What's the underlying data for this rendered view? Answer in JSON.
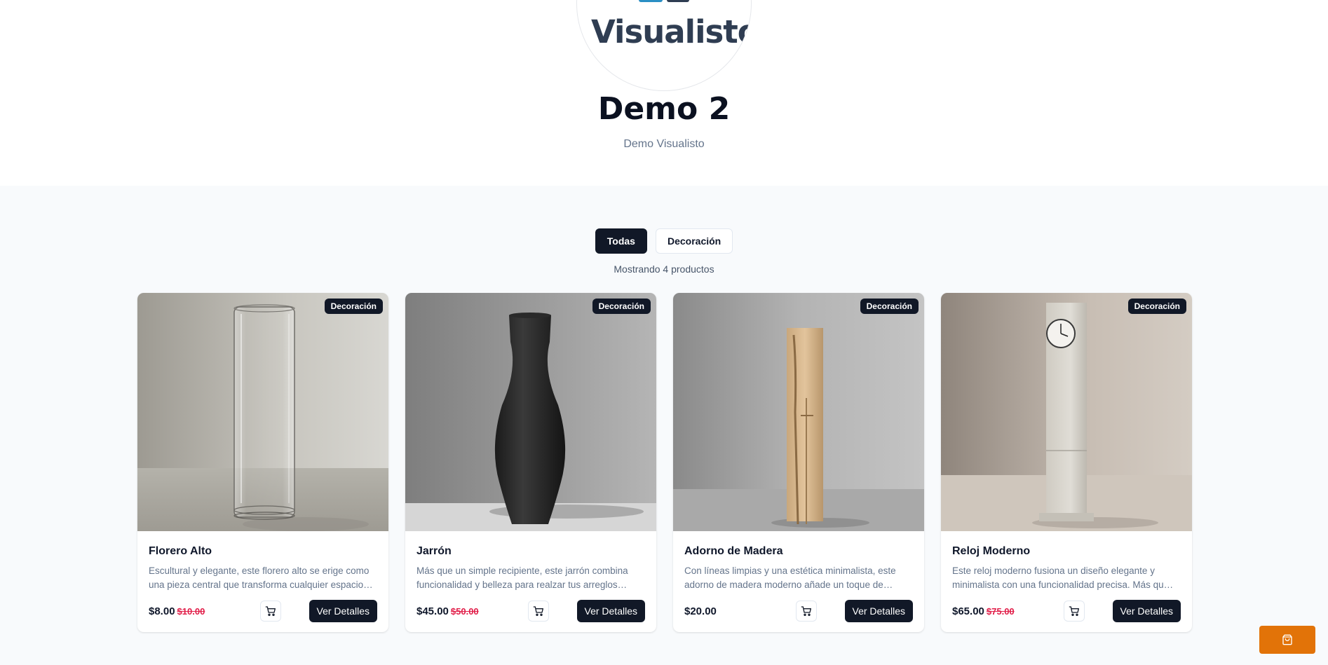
{
  "brand": {
    "logo_text": "Visualisto",
    "registered": "®"
  },
  "header": {
    "title": "Demo 2",
    "subtitle": "Demo Visualisto"
  },
  "filters": [
    {
      "label": "Todas",
      "active": true
    },
    {
      "label": "Decoración",
      "active": false
    }
  ],
  "results_text": "Mostrando 4 productos",
  "products": [
    {
      "title": "Florero Alto",
      "category": "Decoración",
      "description": "Escultural y elegante, este florero alto se erige como una pieza central que transforma cualquier espacio…",
      "price": "$8.00",
      "old_price": "$10.00",
      "details_label": "Ver Detalles",
      "image": "glass-vase"
    },
    {
      "title": "Jarrón",
      "category": "Decoración",
      "description": "Más que un simple recipiente, este jarrón combina funcionalidad y belleza para realzar tus arreglos…",
      "price": "$45.00",
      "old_price": "$50.00",
      "details_label": "Ver Detalles",
      "image": "black-vase"
    },
    {
      "title": "Adorno de Madera",
      "category": "Decoración",
      "description": "Con líneas limpias y una estética minimalista, este adorno de madera moderno añade un toque de…",
      "price": "$20.00",
      "old_price": "",
      "details_label": "Ver Detalles",
      "image": "wood-ornament"
    },
    {
      "title": "Reloj Moderno",
      "category": "Decoración",
      "description": "Este reloj moderno fusiona un diseño elegante y minimalista con una funcionalidad precisa. Más qu…",
      "price": "$65.00",
      "old_price": "$75.00",
      "details_label": "Ver Detalles",
      "image": "floor-clock"
    }
  ],
  "colors": {
    "primary": "#111827",
    "accent": "#e27308",
    "sale": "#e11d48",
    "background": "#f8fafc"
  },
  "icons": {
    "cart": "cart-icon",
    "floating": "shopping-bag-icon"
  }
}
